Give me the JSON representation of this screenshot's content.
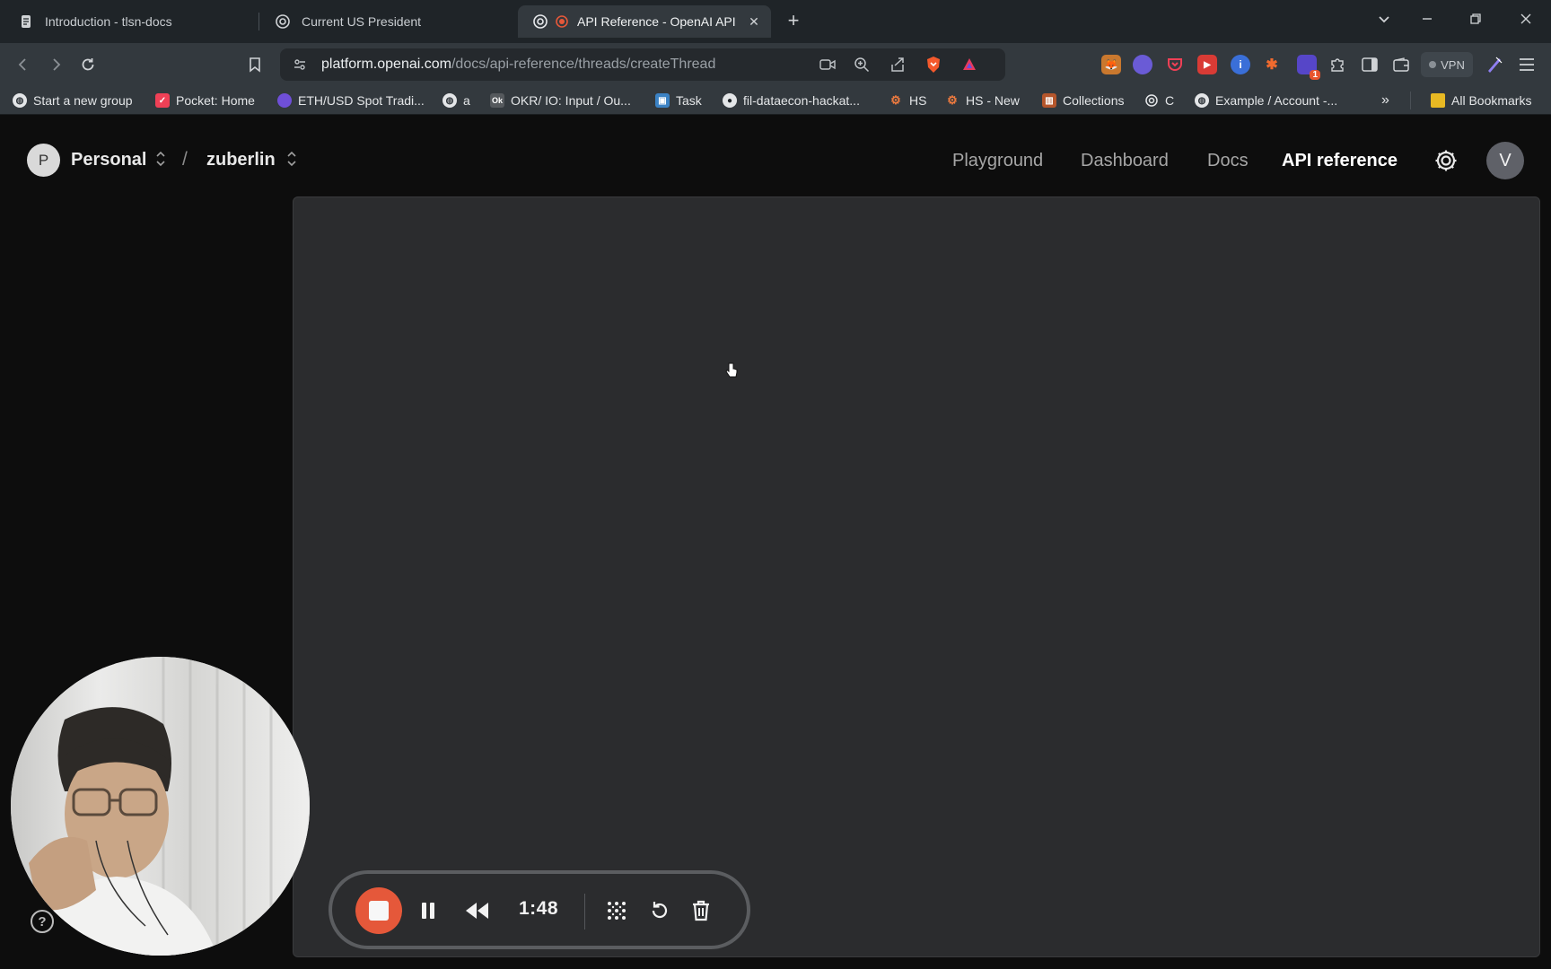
{
  "browser": {
    "tabs": [
      {
        "title": "Introduction - tlsn-docs",
        "icon": "doc-icon",
        "active": false
      },
      {
        "title": "Current US President",
        "icon": "openai-icon",
        "active": false
      },
      {
        "title": "API Reference - OpenAI API",
        "icon": "openai-icon",
        "active": true,
        "recording": true
      }
    ],
    "url": {
      "host": "platform.openai.com",
      "path": "/docs/api-reference/threads/createThread"
    },
    "vpn_label": "VPN",
    "extension_badge": "1",
    "bookmarks": [
      {
        "label": "Start a new group",
        "icon": "globe-icon"
      },
      {
        "label": "Pocket: Home",
        "icon": "pocket-icon"
      },
      {
        "label": "ETH/USD Spot Tradi...",
        "icon": "cloud-icon"
      },
      {
        "label": "a",
        "icon": "globe-icon"
      },
      {
        "label": "OKR/ IO: Input / Ou...",
        "icon": "ok-icon"
      },
      {
        "label": "Task",
        "icon": "box-icon"
      },
      {
        "label": "fil-dataecon-hackat...",
        "icon": "github-icon"
      },
      {
        "label": "HS",
        "icon": "hubspot-icon"
      },
      {
        "label": "HS - New",
        "icon": "hubspot-icon"
      },
      {
        "label": "Collections",
        "icon": "chart-icon"
      },
      {
        "label": "C",
        "icon": "openai-icon"
      },
      {
        "label": "Example / Account -...",
        "icon": "globe-icon"
      }
    ],
    "all_bookmarks_label": "All Bookmarks"
  },
  "header": {
    "org_initial": "P",
    "org_name": "Personal",
    "separator": "/",
    "project_name": "zuberlin",
    "nav": [
      {
        "label": "Playground",
        "active": false
      },
      {
        "label": "Dashboard",
        "active": false
      },
      {
        "label": "Docs",
        "active": false
      },
      {
        "label": "API reference",
        "active": true
      }
    ],
    "user_initial": "V"
  },
  "recorder": {
    "elapsed": "1:48"
  },
  "colors": {
    "accent_record": "#e5583a",
    "page_bg": "#0d0d0d",
    "panel_bg": "#2b2c2e"
  }
}
